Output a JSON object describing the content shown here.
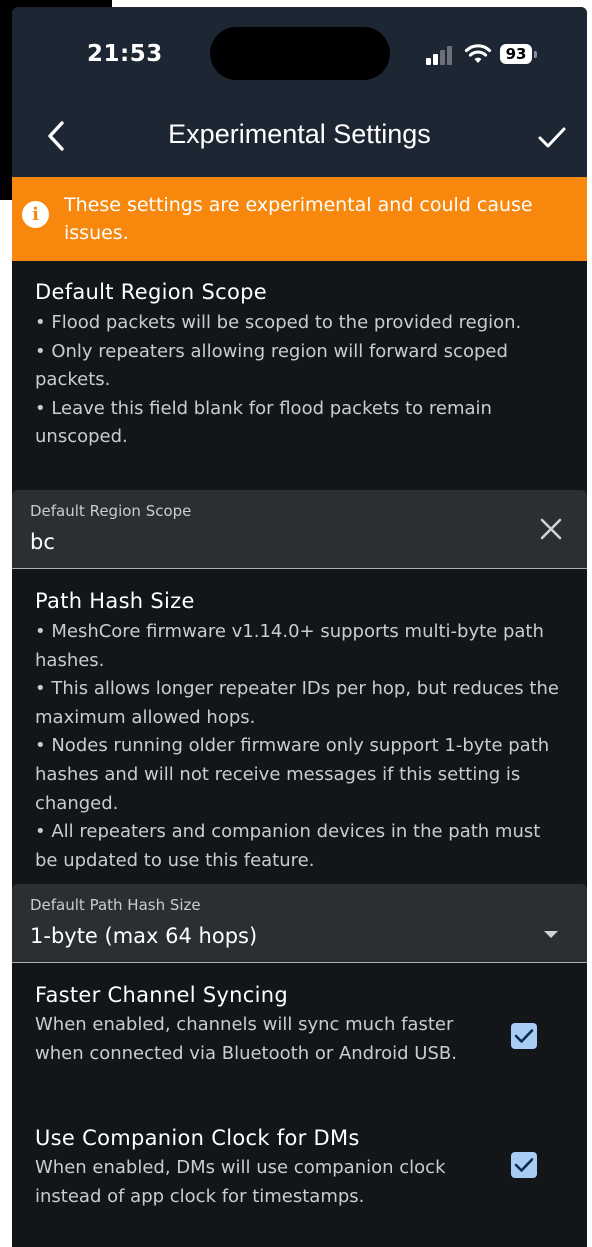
{
  "status_bar": {
    "time": "21:53",
    "battery": "93"
  },
  "header": {
    "title": "Experimental Settings"
  },
  "warning": {
    "text": "These settings are experimental and could cause issues."
  },
  "region_scope": {
    "title": "Default Region Scope",
    "bullets": [
      "• Flood packets will be scoped to the provided region.",
      "• Only repeaters allowing region will forward scoped packets.",
      "• Leave this field blank for flood packets to remain unscoped."
    ],
    "field_label": "Default Region Scope",
    "field_value": "bc"
  },
  "path_hash": {
    "title": "Path Hash Size",
    "bullets": [
      "• MeshCore firmware v1.14.0+ supports multi-byte path hashes.",
      "• This allows longer repeater IDs per hop, but reduces the maximum allowed hops.",
      "• Nodes running older firmware only support 1-byte path hashes and will not receive messages if this setting is changed.",
      "• All repeaters and companion devices in the path must be updated to use this feature."
    ],
    "field_label": "Default Path Hash Size",
    "selected_value": "1-byte (max 64 hops)"
  },
  "toggles": [
    {
      "title": "Faster Channel Syncing",
      "description": "When enabled, channels will sync much faster when connected via Bluetooth or Android USB.",
      "checked": true
    },
    {
      "title": "Use Companion Clock for DMs",
      "description": "When enabled, DMs will use companion clock instead of app clock for timestamps.",
      "checked": true
    }
  ],
  "colors": {
    "topbar": "#1d2733",
    "background": "#121619",
    "warning": "#f7880d",
    "checkbox": "#a8cdf4"
  },
  "icons": [
    "chevron-left-icon",
    "checkmark-icon",
    "info-icon",
    "close-icon",
    "dropdown-arrow-icon",
    "signal-icon",
    "wifi-icon",
    "battery-icon"
  ]
}
